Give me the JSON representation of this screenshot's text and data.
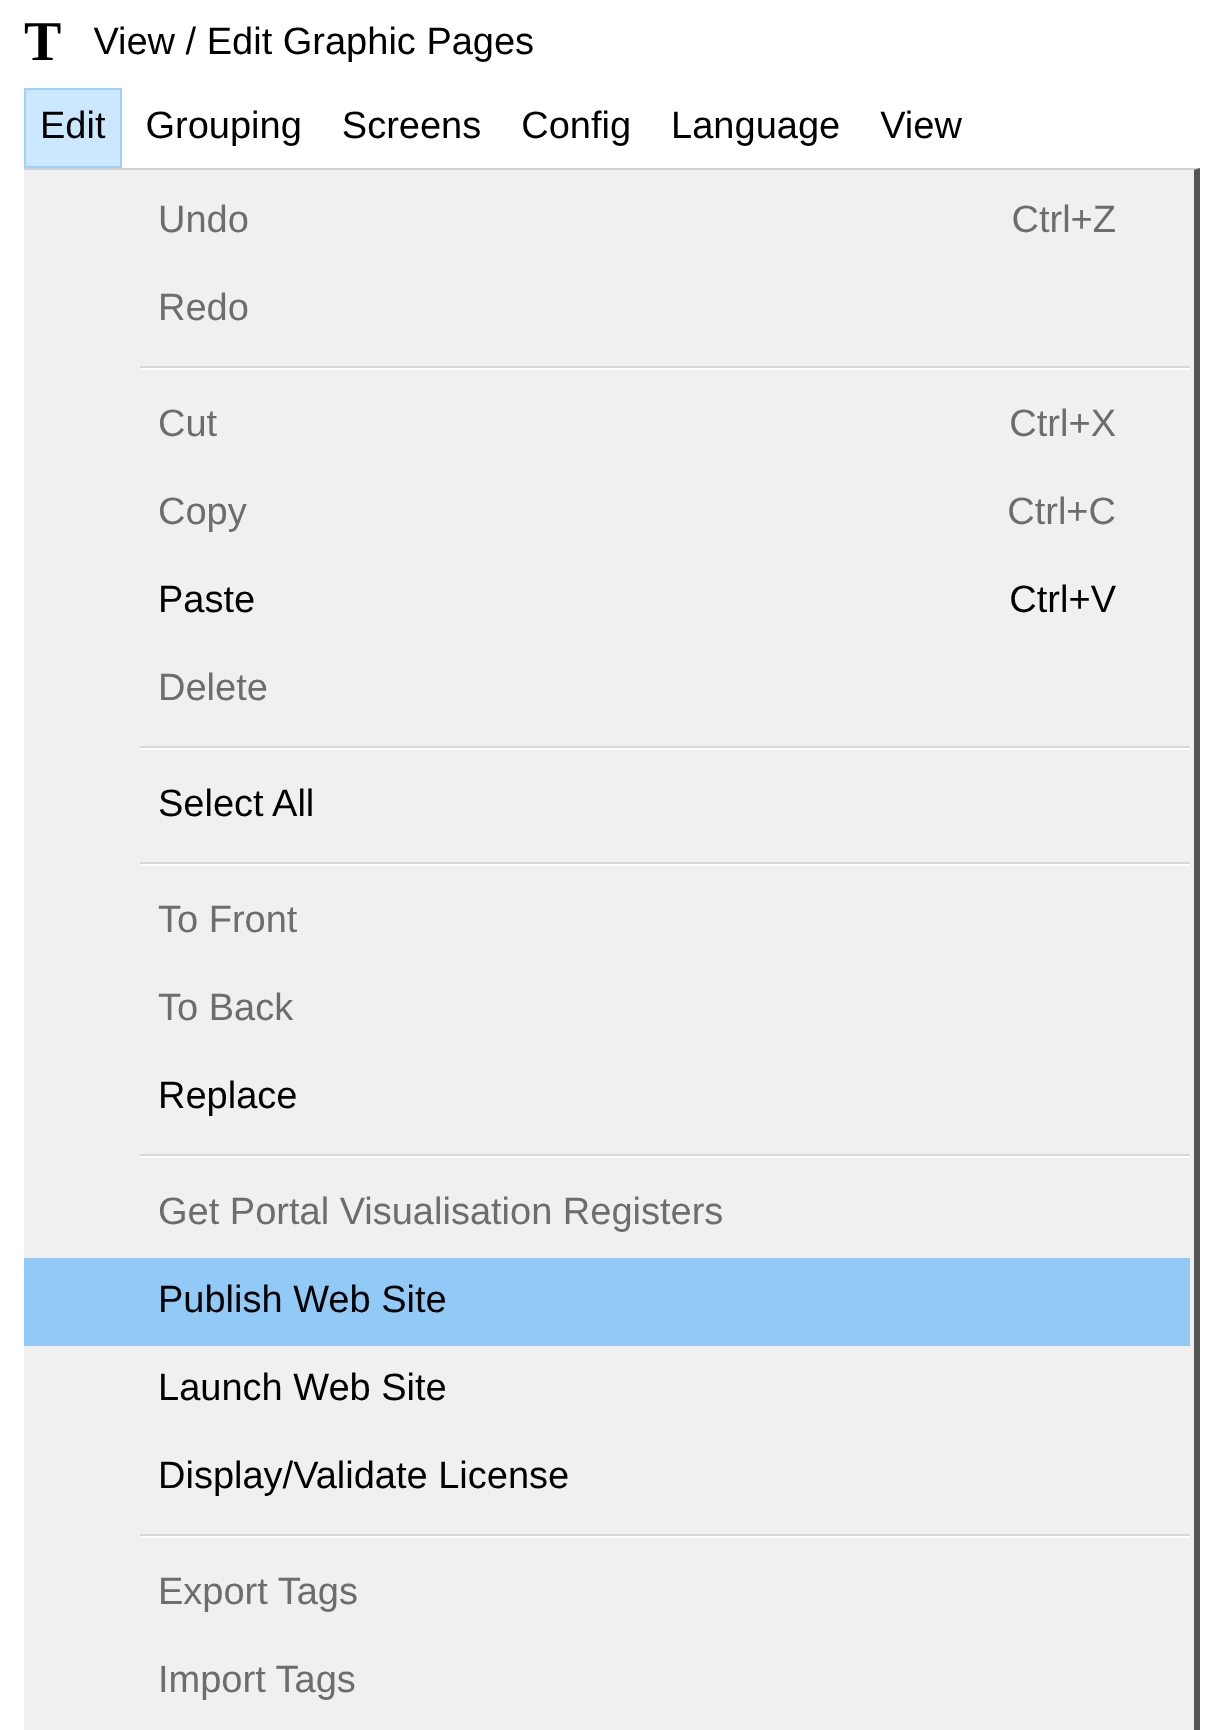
{
  "window": {
    "title": "View / Edit Graphic Pages",
    "icon_letter": "T"
  },
  "menubar": [
    {
      "label": "Edit",
      "selected": true
    },
    {
      "label": "Grouping",
      "selected": false
    },
    {
      "label": "Screens",
      "selected": false
    },
    {
      "label": "Config",
      "selected": false
    },
    {
      "label": "Language",
      "selected": false
    },
    {
      "label": "View",
      "selected": false
    }
  ],
  "menu": {
    "groups": [
      [
        {
          "label": "Undo",
          "shortcut": "Ctrl+Z",
          "disabled": true,
          "selected": false
        },
        {
          "label": "Redo",
          "disabled": true,
          "selected": false
        }
      ],
      [
        {
          "label": "Cut",
          "shortcut": "Ctrl+X",
          "disabled": true,
          "selected": false
        },
        {
          "label": "Copy",
          "shortcut": "Ctrl+C",
          "disabled": true,
          "selected": false
        },
        {
          "label": "Paste",
          "shortcut": "Ctrl+V",
          "disabled": false,
          "selected": false
        },
        {
          "label": "Delete",
          "disabled": true,
          "selected": false
        }
      ],
      [
        {
          "label": "Select All",
          "disabled": false,
          "selected": false
        }
      ],
      [
        {
          "label": "To Front",
          "disabled": true,
          "selected": false
        },
        {
          "label": "To Back",
          "disabled": true,
          "selected": false
        },
        {
          "label": "Replace",
          "disabled": false,
          "selected": false
        }
      ],
      [
        {
          "label": "Get Portal Visualisation Registers",
          "disabled": true,
          "selected": false
        },
        {
          "label": "Publish Web Site",
          "disabled": false,
          "selected": true
        },
        {
          "label": "Launch Web Site",
          "disabled": false,
          "selected": false
        },
        {
          "label": "Display/Validate License",
          "disabled": false,
          "selected": false
        }
      ],
      [
        {
          "label": "Export Tags",
          "disabled": true,
          "selected": false
        },
        {
          "label": "Import Tags",
          "disabled": true,
          "selected": false
        }
      ]
    ]
  }
}
